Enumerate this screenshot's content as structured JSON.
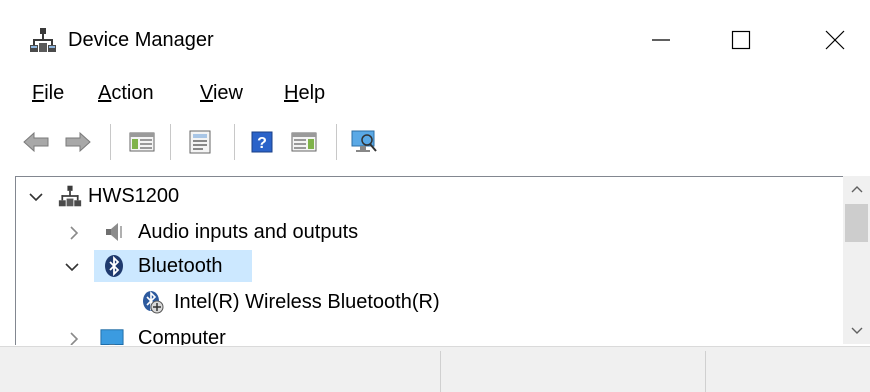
{
  "window": {
    "title": "Device Manager",
    "icon": "device-manager-icon",
    "controls": {
      "minimize": "minimize-icon",
      "maximize": "maximize-icon",
      "close": "close-icon"
    }
  },
  "menu": {
    "items": [
      {
        "accel": "F",
        "rest": "ile"
      },
      {
        "accel": "A",
        "rest": "ction"
      },
      {
        "accel": "V",
        "rest": "iew"
      },
      {
        "accel": "H",
        "rest": "elp"
      }
    ]
  },
  "toolbar": {
    "buttons": [
      "back-arrow-icon",
      "forward-arrow-icon",
      "show-hide-console-tree-icon",
      "properties-icon",
      "help-icon",
      "action-pane-icon",
      "scan-for-hardware-changes-icon"
    ]
  },
  "tree": {
    "items": [
      {
        "label": "HWS1200",
        "icon": "computer-root-icon",
        "state": "expanded"
      },
      {
        "label": "Audio inputs and outputs",
        "icon": "speaker-icon",
        "state": "collapsed"
      },
      {
        "label": "Bluetooth",
        "icon": "bluetooth-icon",
        "state": "expanded",
        "selected": true
      },
      {
        "label": "Intel(R) Wireless Bluetooth(R)",
        "icon": "bluetooth-device-icon",
        "state": "leaf"
      },
      {
        "label": "Computer",
        "icon": "monitor-icon",
        "state": "collapsed"
      }
    ]
  },
  "colors": {
    "selection": "#cce8ff",
    "statusbar": "#f0f0f0",
    "scrollbar_track": "#f0f0f0",
    "scrollbar_thumb": "#cdcdcd"
  },
  "statusbar": {
    "cells": [
      "",
      "",
      ""
    ]
  }
}
